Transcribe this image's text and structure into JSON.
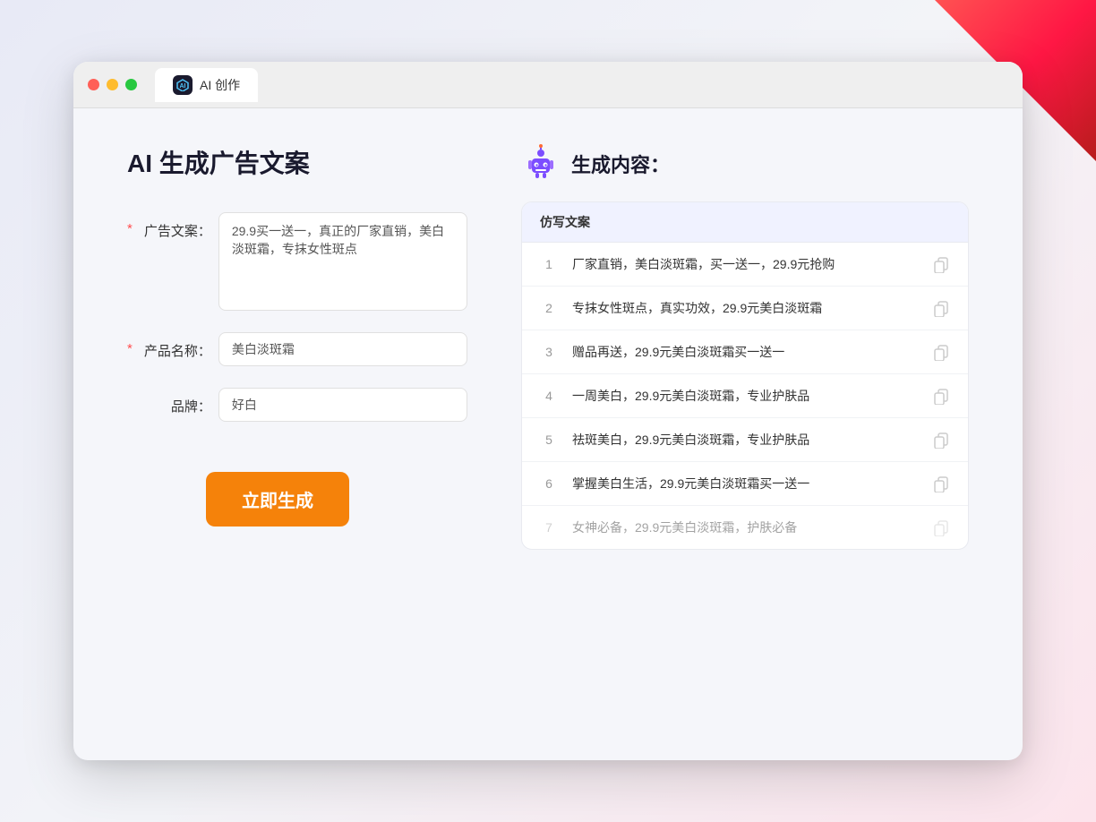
{
  "window": {
    "tab_label": "AI 创作"
  },
  "page": {
    "title": "AI 生成广告文案"
  },
  "form": {
    "ad_copy_label": "广告文案：",
    "ad_copy_required": "*",
    "ad_copy_value": "29.9买一送一，真正的厂家直销，美白淡斑霜，专抹女性斑点",
    "product_name_label": "产品名称：",
    "product_name_required": "*",
    "product_name_value": "美白淡斑霜",
    "brand_label": "品牌：",
    "brand_value": "好白",
    "generate_button": "立即生成"
  },
  "result": {
    "title": "生成内容：",
    "column_header": "仿写文案",
    "items": [
      {
        "number": "1",
        "text": "厂家直销，美白淡斑霜，买一送一，29.9元抢购",
        "dimmed": false
      },
      {
        "number": "2",
        "text": "专抹女性斑点，真实功效，29.9元美白淡斑霜",
        "dimmed": false
      },
      {
        "number": "3",
        "text": "赠品再送，29.9元美白淡斑霜买一送一",
        "dimmed": false
      },
      {
        "number": "4",
        "text": "一周美白，29.9元美白淡斑霜，专业护肤品",
        "dimmed": false
      },
      {
        "number": "5",
        "text": "祛斑美白，29.9元美白淡斑霜，专业护肤品",
        "dimmed": false
      },
      {
        "number": "6",
        "text": "掌握美白生活，29.9元美白淡斑霜买一送一",
        "dimmed": false
      },
      {
        "number": "7",
        "text": "女神必备，29.9元美白淡斑霜，护肤必备",
        "dimmed": true
      }
    ]
  }
}
